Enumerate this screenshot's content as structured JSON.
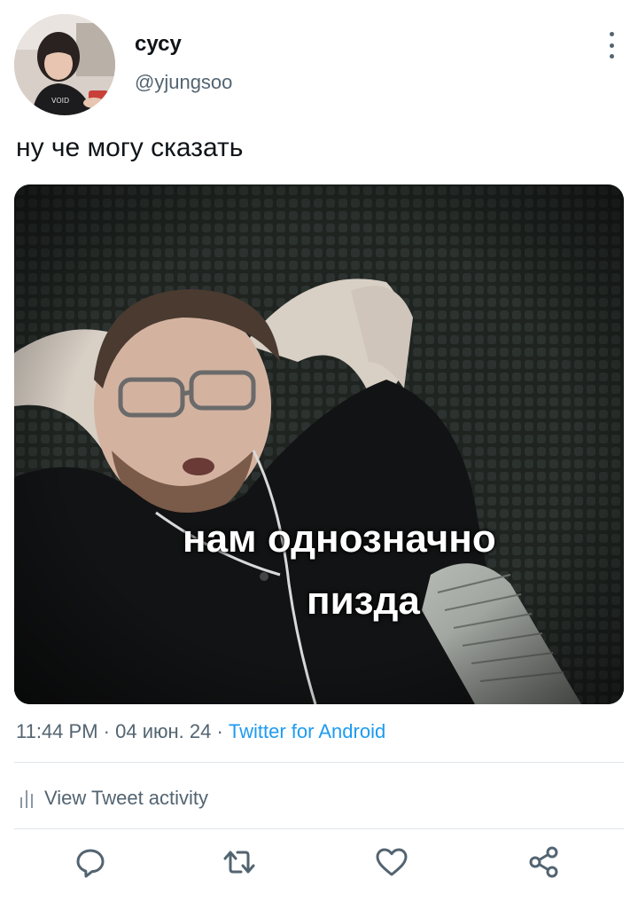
{
  "author": {
    "display_name": "сусу",
    "handle": "@yjungsoo",
    "avatar_icon": "profile-photo"
  },
  "tweet": {
    "text": "ну че могу сказать"
  },
  "media": {
    "caption_line1": "нам однозначно",
    "caption_line2": "пизда"
  },
  "meta": {
    "time": "11:44 PM",
    "date": "04 июн. 24",
    "source": "Twitter for Android",
    "separator": " · "
  },
  "activity": {
    "label": "View Tweet activity",
    "icon": "bar-chart-icon"
  },
  "actions": [
    {
      "name": "reply",
      "icon": "reply-icon"
    },
    {
      "name": "retweet",
      "icon": "retweet-icon"
    },
    {
      "name": "like",
      "icon": "heart-icon"
    },
    {
      "name": "share",
      "icon": "share-icon"
    }
  ],
  "colors": {
    "accent": "#1d9bf0",
    "muted": "#536471",
    "text": "#0f1419"
  }
}
